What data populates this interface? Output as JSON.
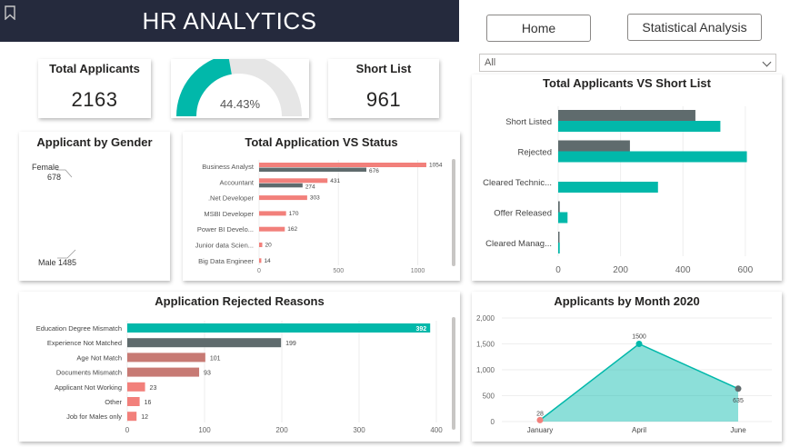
{
  "header": {
    "title": "HR ANALYTICS"
  },
  "nav": {
    "home_label": "Home",
    "stats_label": "Statistical Analysis"
  },
  "filter": {
    "selected": "All"
  },
  "kpi": {
    "total_applicants_title": "Total Applicants",
    "total_applicants_value": "2163",
    "gauge_value": "44.43%",
    "gauge_fraction": 0.4443,
    "short_list_title": "Short List",
    "short_list_value": "961"
  },
  "colors": {
    "teal": "#01b8aa",
    "gray": "#5f6b6d",
    "salmon": "#f2807b",
    "rose": "#c77a74",
    "header": "#252a3d"
  },
  "chart_data": [
    {
      "id": "gender",
      "type": "pie",
      "title": "Applicant by Gender",
      "labels": [
        "Female",
        "Male"
      ],
      "values": [
        678,
        1485
      ],
      "label_texts": [
        "Female",
        "678",
        "Male 1485"
      ]
    },
    {
      "id": "status",
      "type": "bar",
      "title": "Total Application VS Status",
      "categories": [
        "Business Analyst",
        "Accountant",
        ".Net Developer",
        "MSBI Developer",
        "Power BI Develo...",
        "Junior data Scien...",
        "Big Data Engineer"
      ],
      "series": [
        {
          "values": [
            1054,
            431,
            303,
            170,
            162,
            20,
            14
          ]
        },
        {
          "values": [
            676,
            274,
            null,
            null,
            null,
            null,
            null
          ]
        }
      ],
      "xlim": [
        0,
        1100
      ],
      "xticks": [
        "0",
        "500",
        "1000"
      ]
    },
    {
      "id": "shortlist",
      "type": "bar",
      "title": "Total Applicants VS Short List",
      "categories": [
        "Short Listed",
        "Rejected",
        "Cleared Technic...",
        "Offer Released",
        "Cleared Manag..."
      ],
      "series": [
        {
          "values": [
            440,
            230,
            0,
            5,
            2
          ]
        },
        {
          "values": [
            520,
            605,
            320,
            30,
            5
          ]
        }
      ],
      "xlim": [
        0,
        650
      ],
      "xticks": [
        "0",
        "200",
        "400",
        "600"
      ]
    },
    {
      "id": "rejected",
      "type": "bar",
      "title": "Application Rejected Reasons",
      "categories": [
        "Education Degree Mismatch",
        "Experience Not Matched",
        "Age Not Match",
        "Documents Mismatch",
        "Applicant Not Working",
        "Other",
        "Job for Males only"
      ],
      "values": [
        392,
        199,
        101,
        93,
        23,
        16,
        12
      ],
      "value_labels": [
        "392",
        "199",
        "101",
        "93",
        "23",
        "16",
        "12"
      ],
      "xlim": [
        0,
        400
      ],
      "xticks": [
        "0",
        "100",
        "200",
        "300",
        "400"
      ]
    },
    {
      "id": "month",
      "type": "area",
      "title": "Applicants by Month 2020",
      "categories": [
        "January",
        "April",
        "June"
      ],
      "values": [
        28,
        1500,
        635
      ],
      "value_labels": [
        "28",
        "1500",
        "635"
      ],
      "ylim": [
        0,
        2000
      ],
      "yticks": [
        "0",
        "500",
        "1,000",
        "1,500",
        "2,000"
      ]
    }
  ]
}
